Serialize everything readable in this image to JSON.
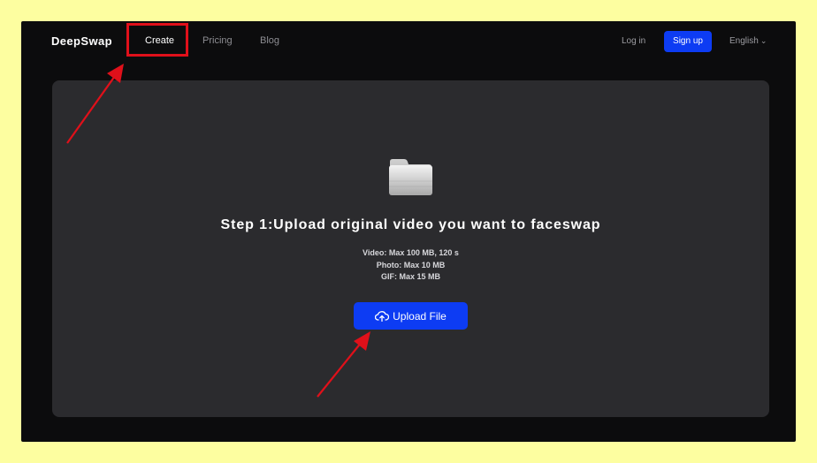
{
  "navbar": {
    "logo": "DeepSwap",
    "links": [
      "Create",
      "Pricing",
      "Blog"
    ],
    "login": "Log in",
    "signup": "Sign up",
    "language": "English",
    "language_icon": "chevron-down-icon"
  },
  "upload": {
    "icon": "folder-icon",
    "title": "Step 1:Upload original video you want to faceswap",
    "limits": [
      "Video:  Max 100 MB, 120 s",
      "Photo: Max 10 MB",
      "GIF: Max 15 MB"
    ],
    "button_label": "Upload File",
    "button_icon": "cloud-upload-icon"
  },
  "colors": {
    "background": "#fdfea0",
    "window": "#0c0c0d",
    "panel": "#2b2b2e",
    "accent": "#0d3cf3",
    "annotation": "#e0101a"
  },
  "annotations": {
    "highlight": "red-box-around-create",
    "arrows": [
      "arrow-to-create",
      "arrow-to-upload-button"
    ]
  }
}
